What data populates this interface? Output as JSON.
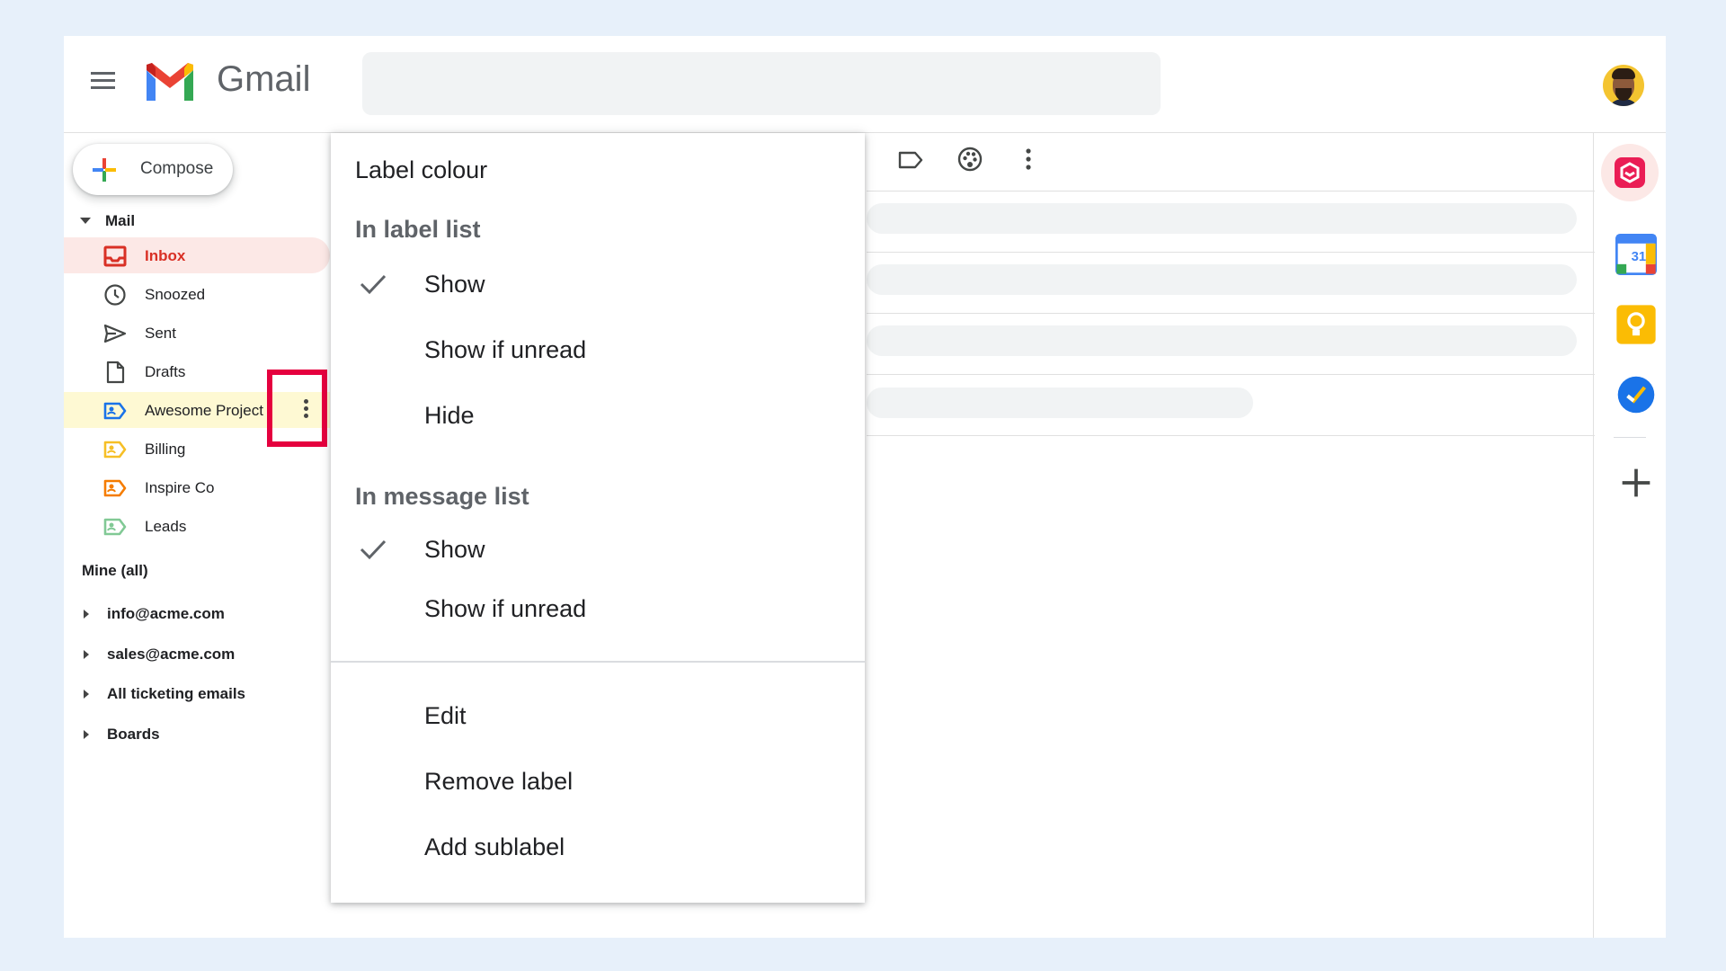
{
  "header": {
    "brand": "Gmail",
    "search_placeholder": ""
  },
  "sidebar": {
    "compose_label": "Compose",
    "mail_section": "Mail",
    "items": [
      {
        "label": "Inbox",
        "icon": "inbox-icon",
        "color": "#d93025"
      },
      {
        "label": "Snoozed",
        "icon": "clock-icon",
        "color": "#444746"
      },
      {
        "label": "Sent",
        "icon": "send-icon",
        "color": "#444746"
      },
      {
        "label": "Drafts",
        "icon": "draft-icon",
        "color": "#444746"
      },
      {
        "label": "Awesome Project",
        "icon": "label-icon",
        "color": "#1a73e8"
      },
      {
        "label": "Billing",
        "icon": "label-icon",
        "color": "#f6bf26"
      },
      {
        "label": "Inspire Co",
        "icon": "label-icon",
        "color": "#f57c00"
      },
      {
        "label": "Leads",
        "icon": "label-icon",
        "color": "#81c995"
      }
    ],
    "mine_section": "Mine (all)",
    "accounts": [
      {
        "label": "info@acme.com"
      },
      {
        "label": "sales@acme.com"
      },
      {
        "label": "All ticketing emails"
      },
      {
        "label": "Boards"
      }
    ]
  },
  "menu": {
    "title": "Label colour",
    "label_list_heading": "In label list",
    "label_list_options": [
      {
        "label": "Show",
        "checked": true
      },
      {
        "label": "Show if unread",
        "checked": false
      },
      {
        "label": "Hide",
        "checked": false
      }
    ],
    "message_list_heading": "In message list",
    "message_list_options": [
      {
        "label": "Show",
        "checked": true
      },
      {
        "label": "Show if unread",
        "checked": false
      }
    ],
    "actions": [
      {
        "label": "Edit"
      },
      {
        "label": "Remove label"
      },
      {
        "label": "Add sublabel"
      }
    ]
  },
  "colors": {
    "highlight": "#e5003e",
    "inbox_active": "#d93025",
    "hover_row": "#fef9d3"
  }
}
